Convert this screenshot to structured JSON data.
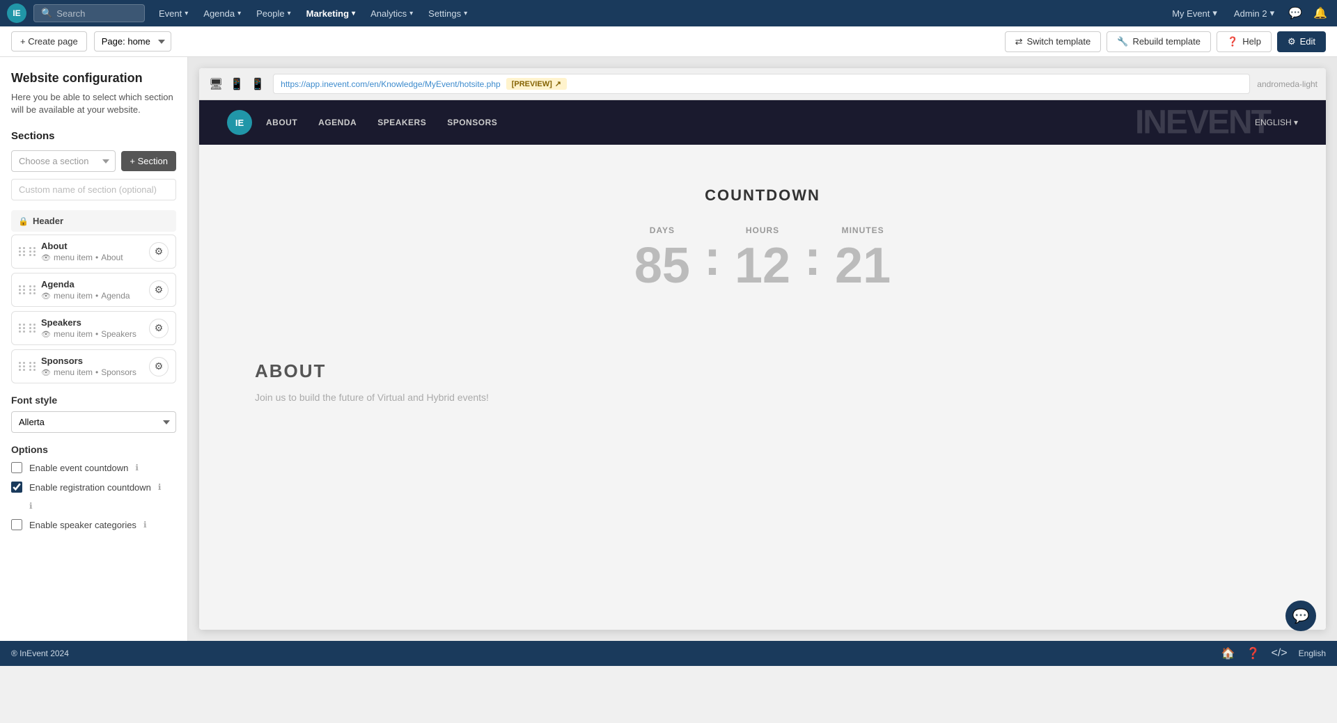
{
  "topnav": {
    "search_placeholder": "Search",
    "logo_text": "IE",
    "nav_items": [
      {
        "label": "Event",
        "has_dropdown": true
      },
      {
        "label": "Agenda",
        "has_dropdown": true
      },
      {
        "label": "People",
        "has_dropdown": true
      },
      {
        "label": "Marketing",
        "has_dropdown": true,
        "active": true
      },
      {
        "label": "Analytics",
        "has_dropdown": true
      },
      {
        "label": "Settings",
        "has_dropdown": true
      }
    ],
    "my_event_label": "My Event",
    "admin_label": "Admin 2"
  },
  "toolbar": {
    "create_page_label": "+ Create page",
    "page_select_value": "Page: home",
    "switch_template_label": "Switch template",
    "rebuild_template_label": "Rebuild template",
    "help_label": "Help",
    "edit_label": "Edit"
  },
  "sidebar": {
    "title": "Website configuration",
    "subtitle": "Here you be able to select which section will be available at your website.",
    "sections_label": "Sections",
    "choose_section_placeholder": "Choose a section",
    "add_section_label": "+ Section",
    "custom_name_placeholder": "Custom name of section (optional)",
    "header_label": "Header",
    "sections": [
      {
        "name": "About",
        "meta_type": "menu item",
        "meta_name": "About"
      },
      {
        "name": "Agenda",
        "meta_type": "menu item",
        "meta_name": "Agenda"
      },
      {
        "name": "Speakers",
        "meta_type": "menu item",
        "meta_name": "Speakers"
      },
      {
        "name": "Sponsors",
        "meta_type": "menu item",
        "meta_name": "Sponsors"
      }
    ],
    "font_style_label": "Font style",
    "font_value": "Allerta",
    "options_label": "Options",
    "options": [
      {
        "label": "Enable event countdown",
        "checked": false,
        "has_info": true
      },
      {
        "label": "Enable registration countdown",
        "checked": true,
        "has_info": true
      },
      {
        "label": "Enable speaker categories",
        "checked": false,
        "has_info": true
      }
    ]
  },
  "preview": {
    "url": "https://app.inevent.com/en/Knowledge/MyEvent/hotsite.php",
    "preview_label": "[PREVIEW]",
    "template_name": "andromeda-light"
  },
  "website": {
    "nav_links": [
      "ABOUT",
      "AGENDA",
      "SPEAKERS",
      "SPONSORS"
    ],
    "brand_text": "InEvent",
    "lang_label": "ENGLISH ▾",
    "countdown_title": "COUNTDOWN",
    "days_label": "DAYS",
    "hours_label": "HOURS",
    "minutes_label": "MINUTES",
    "days_value": "85",
    "hours_value": "12",
    "minutes_value": "21",
    "about_title": "ABOUT",
    "about_text": "Join us to build the future of Virtual and Hybrid events!"
  },
  "bottom_bar": {
    "copyright": "® InEvent 2024",
    "language": "English"
  },
  "chat_bubble_icon": "💬"
}
